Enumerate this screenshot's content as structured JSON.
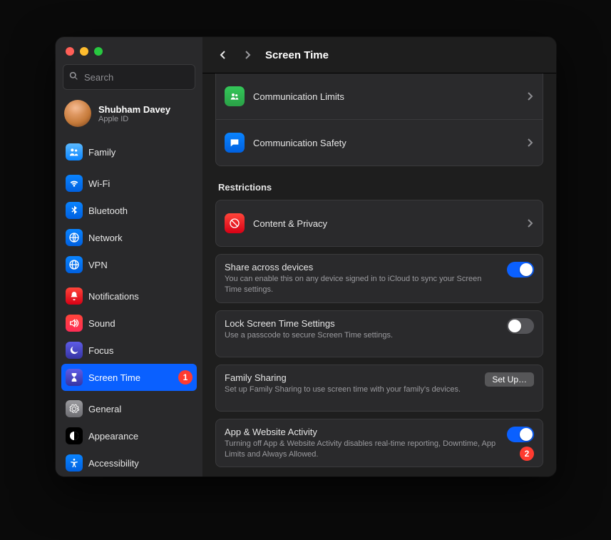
{
  "search": {
    "placeholder": "Search"
  },
  "profile": {
    "name": "Shubham Davey",
    "sub": "Apple ID"
  },
  "sidebar": {
    "family": "Family",
    "items": [
      {
        "label": "Wi-Fi"
      },
      {
        "label": "Bluetooth"
      },
      {
        "label": "Network"
      },
      {
        "label": "VPN"
      }
    ],
    "items2": [
      {
        "label": "Notifications"
      },
      {
        "label": "Sound"
      },
      {
        "label": "Focus"
      },
      {
        "label": "Screen Time"
      }
    ],
    "items3": [
      {
        "label": "General"
      },
      {
        "label": "Appearance"
      },
      {
        "label": "Accessibility"
      }
    ],
    "badge1": "1"
  },
  "header": {
    "title": "Screen Time"
  },
  "rows": {
    "comm_limits": "Communication Limits",
    "comm_safety": "Communication Safety",
    "restrictions_title": "Restrictions",
    "content_privacy": "Content & Privacy",
    "share": {
      "title": "Share across devices",
      "desc": "You can enable this on any device signed in to iCloud to sync your Screen Time settings."
    },
    "lock": {
      "title": "Lock Screen Time Settings",
      "desc": "Use a passcode to secure Screen Time settings."
    },
    "family_sharing": {
      "title": "Family Sharing",
      "desc": "Set up Family Sharing to use screen time with your family's devices.",
      "button": "Set Up…"
    },
    "activity": {
      "title": "App & Website Activity",
      "desc": "Turning off App & Website Activity disables real-time reporting, Downtime, App Limits and Always Allowed."
    },
    "badge2": "2"
  },
  "help": "?"
}
